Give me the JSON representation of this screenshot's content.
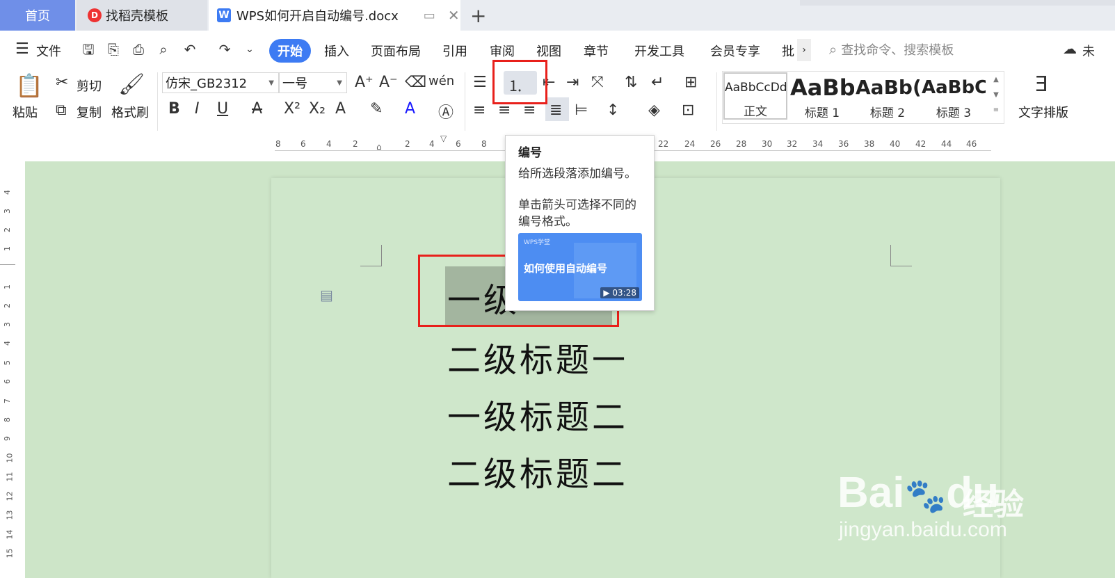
{
  "tabs": {
    "home": "首页",
    "template": "找稻壳模板",
    "document": "WPS如何开启自动编号.docx",
    "new_tab": "+"
  },
  "menu": {
    "file": "文件",
    "items": [
      "开始",
      "插入",
      "页面布局",
      "引用",
      "审阅",
      "视图",
      "章节",
      "开发工具",
      "会员专享",
      "批"
    ],
    "search_placeholder": "查找命令、搜索模板",
    "user_partial": "未"
  },
  "ribbon": {
    "paste": "粘贴",
    "cut": "剪切",
    "copy": "复制",
    "format_painter": "格式刷",
    "font_name": "仿宋_GB2312",
    "font_size": "一号",
    "styles": [
      {
        "preview": "AaBbCcDd",
        "name": "正文"
      },
      {
        "preview": "AaBb",
        "name": "标题 1"
      },
      {
        "preview": "AaBb(",
        "name": "标题 2"
      },
      {
        "preview": "AaBbC",
        "name": "标题 3"
      }
    ],
    "text_layout": "文字排版"
  },
  "ruler": {
    "h_labels": [
      "8",
      "6",
      "4",
      "2",
      "2",
      "4",
      "6",
      "8",
      "22",
      "24",
      "26",
      "28",
      "30",
      "32",
      "34",
      "36",
      "38",
      "40",
      "42",
      "44",
      "46"
    ],
    "v_labels": [
      "4",
      "3",
      "2",
      "1",
      "1",
      "2",
      "3",
      "4",
      "5",
      "6",
      "7",
      "8",
      "9",
      "10",
      "11",
      "12",
      "13",
      "14",
      "15"
    ]
  },
  "document": {
    "headings": [
      "一级",
      "二级标题一",
      "一级标题二",
      "二级标题二"
    ]
  },
  "tooltip": {
    "title": "编号",
    "line1": "给所选段落添加编号。",
    "line2": "单击箭头可选择不同的编号格式。",
    "video_brand": "WPS学堂",
    "video_title": "如何使用自动编号",
    "video_duration": "03:28"
  },
  "watermark": {
    "brand": "Bai",
    "brand_tail": "du",
    "service": "经验",
    "url": "jingyan.baidu.com"
  },
  "colors": {
    "accent": "#3d7bf3",
    "highlight_box": "#e8201b",
    "page_bg": "#cfe7cb",
    "selection": "#a3b59f"
  }
}
